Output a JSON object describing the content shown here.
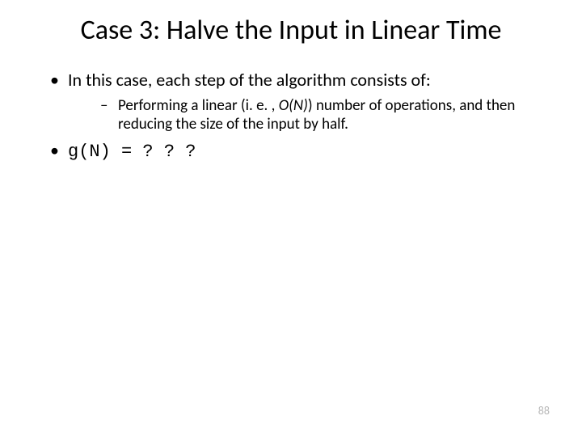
{
  "title": "Case 3: Halve the Input in Linear Time",
  "bullet1": "In this case, each step of the algorithm consists of:",
  "sub1_a": "Performing a linear (i. e. , ",
  "sub1_b": "O(N)",
  "sub1_c": ") number of operations, and then reducing the size of the input by half.",
  "bullet2": "g(N) = ? ? ?",
  "page": "88"
}
